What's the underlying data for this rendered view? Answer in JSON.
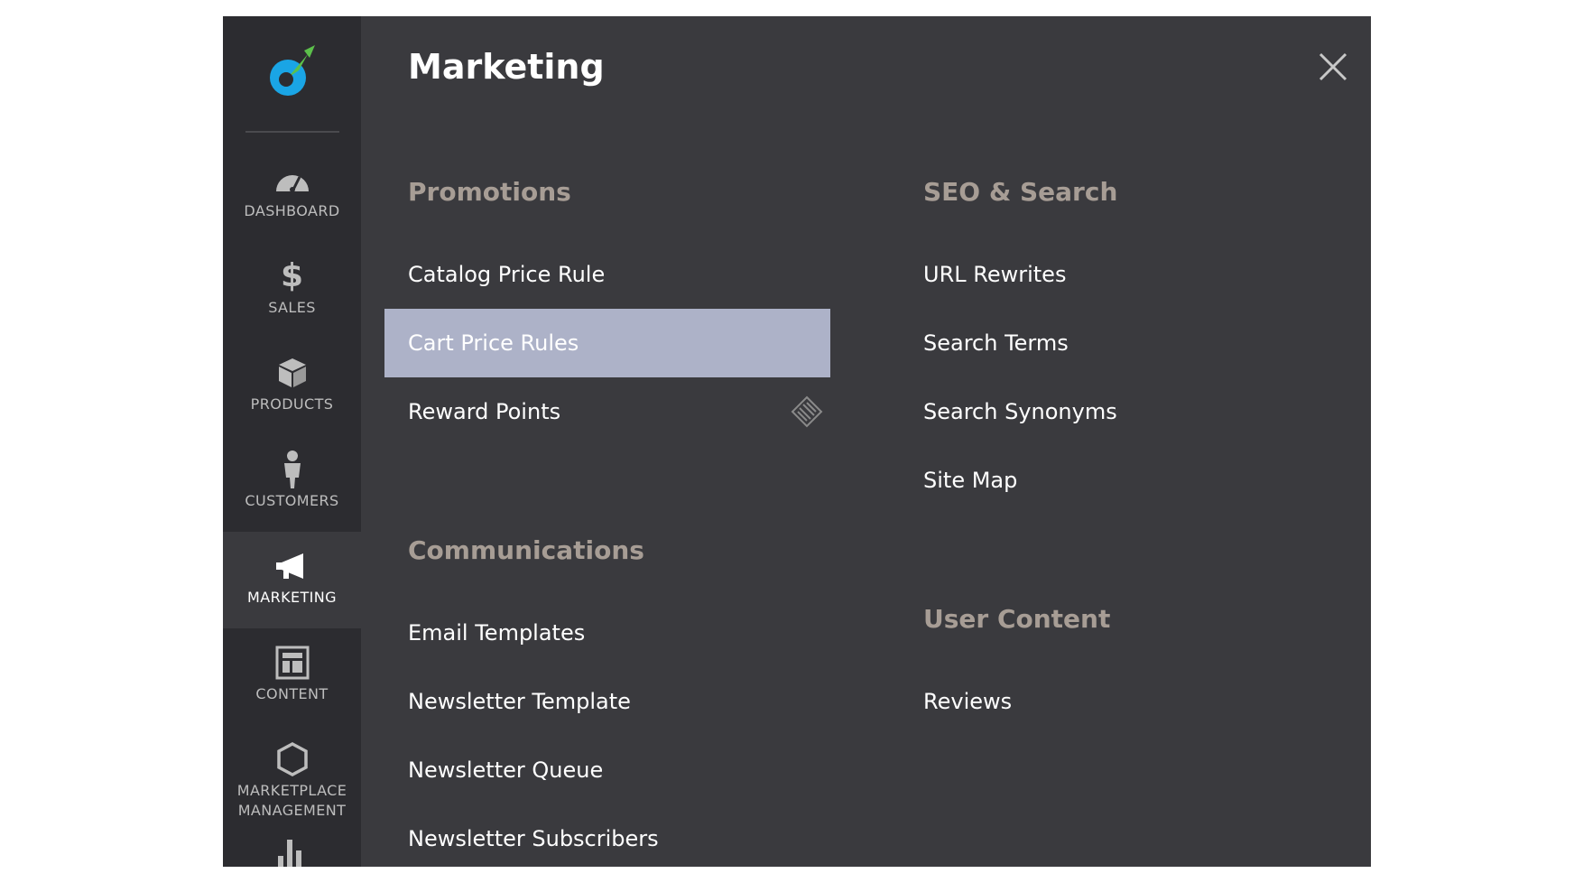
{
  "sidebar": {
    "items": [
      {
        "label": "DASHBOARD",
        "icon": "dashboard-gauge-icon"
      },
      {
        "label": "SALES",
        "icon": "dollar-icon"
      },
      {
        "label": "PRODUCTS",
        "icon": "box-icon"
      },
      {
        "label": "CUSTOMERS",
        "icon": "person-icon"
      },
      {
        "label": "MARKETING",
        "icon": "megaphone-icon",
        "active": true
      },
      {
        "label": "CONTENT",
        "icon": "layout-icon"
      },
      {
        "label": "MARKETPLACE MANAGEMENT",
        "icon": "hexagon-icon"
      }
    ]
  },
  "panel": {
    "title": "Marketing"
  },
  "promotions": {
    "title": "Promotions",
    "items": [
      "Catalog Price Rule",
      "Cart Price Rules",
      "Reward Points"
    ],
    "active_item": "Cart Price Rules"
  },
  "communications": {
    "title": "Communications",
    "items": [
      "Email Templates",
      "Newsletter Template",
      "Newsletter Queue",
      "Newsletter Subscribers"
    ]
  },
  "seo": {
    "title": "SEO & Search",
    "items": [
      "URL Rewrites",
      "Search Terms",
      "Search Synonyms",
      "Site Map"
    ]
  },
  "user_content": {
    "title": "User Content",
    "items": [
      "Reviews"
    ]
  },
  "colors": {
    "panel_bg": "#3a3a3e",
    "sidebar_bg": "#2c2c30",
    "group_title": "#a79d95",
    "active_item_bg": "#adb2c8",
    "logo_blue": "#1aa5e5",
    "logo_green": "#5cc04b"
  }
}
